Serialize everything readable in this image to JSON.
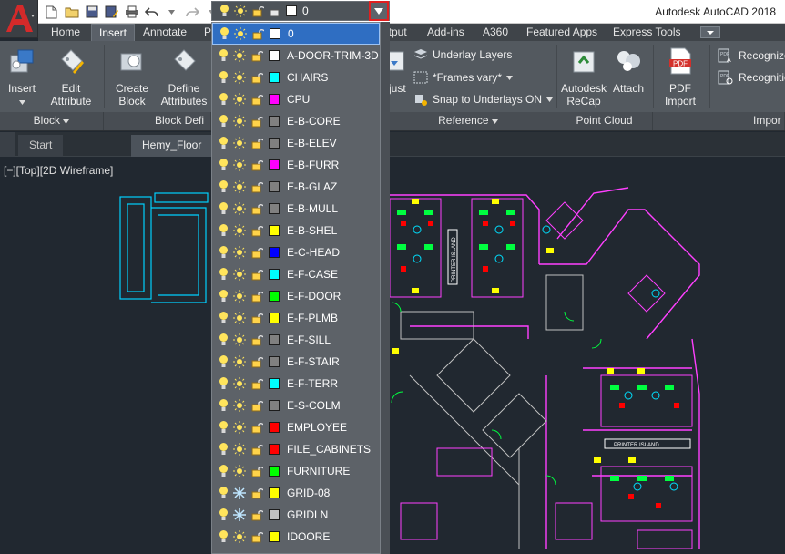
{
  "app": {
    "title": "Autodesk AutoCAD 2018"
  },
  "ribbon": {
    "tabs": [
      {
        "label": "Home"
      },
      {
        "label": "Insert",
        "active": true
      },
      {
        "label": "Annotate"
      },
      {
        "label": "P"
      },
      {
        "label": "utput"
      },
      {
        "label": "Add-ins"
      },
      {
        "label": "A360"
      },
      {
        "label": "Featured Apps"
      },
      {
        "label": "Express Tools"
      }
    ],
    "buttons": {
      "insert": "Insert",
      "edit_attribute": "Edit\nAttribute",
      "create_block": "Create\nBlock",
      "define_attributes": "Define\nAttributes",
      "adjust": "djust",
      "underlay_layers": "Underlay Layers",
      "frames_vary": "*Frames vary*",
      "snap_underlays": "Snap to Underlays ON",
      "autodesk_recap": "Autodesk\nReCap",
      "attach": "Attach",
      "pdf_import": "PDF\nImport",
      "recognize": "Recognize",
      "recognition": "Recognition"
    },
    "panels": {
      "block": "Block",
      "block_definition": "Block Defi",
      "reference": "Reference",
      "point_cloud": "Point Cloud",
      "import": "Impor"
    }
  },
  "doc_tabs": [
    {
      "label": "Start"
    },
    {
      "label": "Hemy_Floor P",
      "active": true
    }
  ],
  "viewport": {
    "label": "[−][Top][2D Wireframe]"
  },
  "printer_island": "PRINTER ISLAND",
  "layer_combo": {
    "current": "0"
  },
  "layers": [
    {
      "name": "0",
      "color": "#ffffff",
      "selected": true
    },
    {
      "name": "A-DOOR-TRIM-3D",
      "color": "#ffffff"
    },
    {
      "name": "CHAIRS",
      "color": "#00ffff"
    },
    {
      "name": "CPU",
      "color": "#ff00ff"
    },
    {
      "name": "E-B-CORE",
      "color": "#808080"
    },
    {
      "name": "E-B-ELEV",
      "color": "#808080"
    },
    {
      "name": "E-B-FURR",
      "color": "#ff00ff"
    },
    {
      "name": "E-B-GLAZ",
      "color": "#808080"
    },
    {
      "name": "E-B-MULL",
      "color": "#808080"
    },
    {
      "name": "E-B-SHEL",
      "color": "#ffff00"
    },
    {
      "name": "E-C-HEAD",
      "color": "#0000ff"
    },
    {
      "name": "E-F-CASE",
      "color": "#00ffff"
    },
    {
      "name": "E-F-DOOR",
      "color": "#00ff00"
    },
    {
      "name": "E-F-PLMB",
      "color": "#ffff00"
    },
    {
      "name": "E-F-SILL",
      "color": "#808080"
    },
    {
      "name": "E-F-STAIR",
      "color": "#808080"
    },
    {
      "name": "E-F-TERR",
      "color": "#00ffff"
    },
    {
      "name": "E-S-COLM",
      "color": "#808080"
    },
    {
      "name": "EMPLOYEE",
      "color": "#ff0000"
    },
    {
      "name": "FILE_CABINETS",
      "color": "#ff0000"
    },
    {
      "name": "FURNITURE",
      "color": "#00ff00"
    },
    {
      "name": "GRID-08",
      "color": "#ffff00",
      "frozen": true
    },
    {
      "name": "GRIDLN",
      "color": "#c0c0c0",
      "frozen": true
    },
    {
      "name": "IDOORE",
      "color": "#ffff00"
    }
  ]
}
